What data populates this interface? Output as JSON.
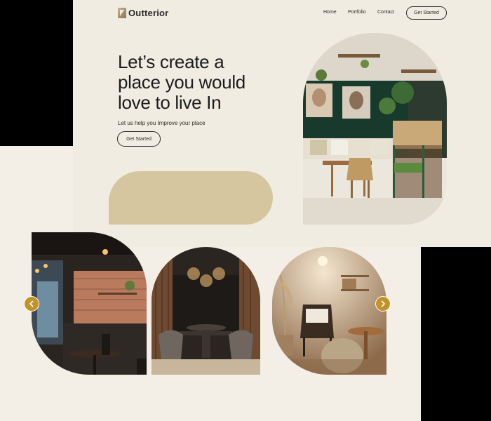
{
  "brand": {
    "name": "Outterior"
  },
  "nav": {
    "home": "Home",
    "portfolio": "Portfolio",
    "contact": "Contact",
    "cta": "Get Started"
  },
  "hero": {
    "headline_line1": "Let’s create a",
    "headline_line2": "place you would",
    "headline_line3": "love to live In",
    "subline": "Let us help you Improve your place",
    "cta": "Get Started"
  },
  "gallery": {
    "prev_icon": "chevron-left-icon",
    "next_icon": "chevron-right-icon"
  },
  "colors": {
    "accent": "#c5922a",
    "tan": "#d5c6a0",
    "background": "#f3efe6",
    "dark": "#1b1b1b"
  }
}
